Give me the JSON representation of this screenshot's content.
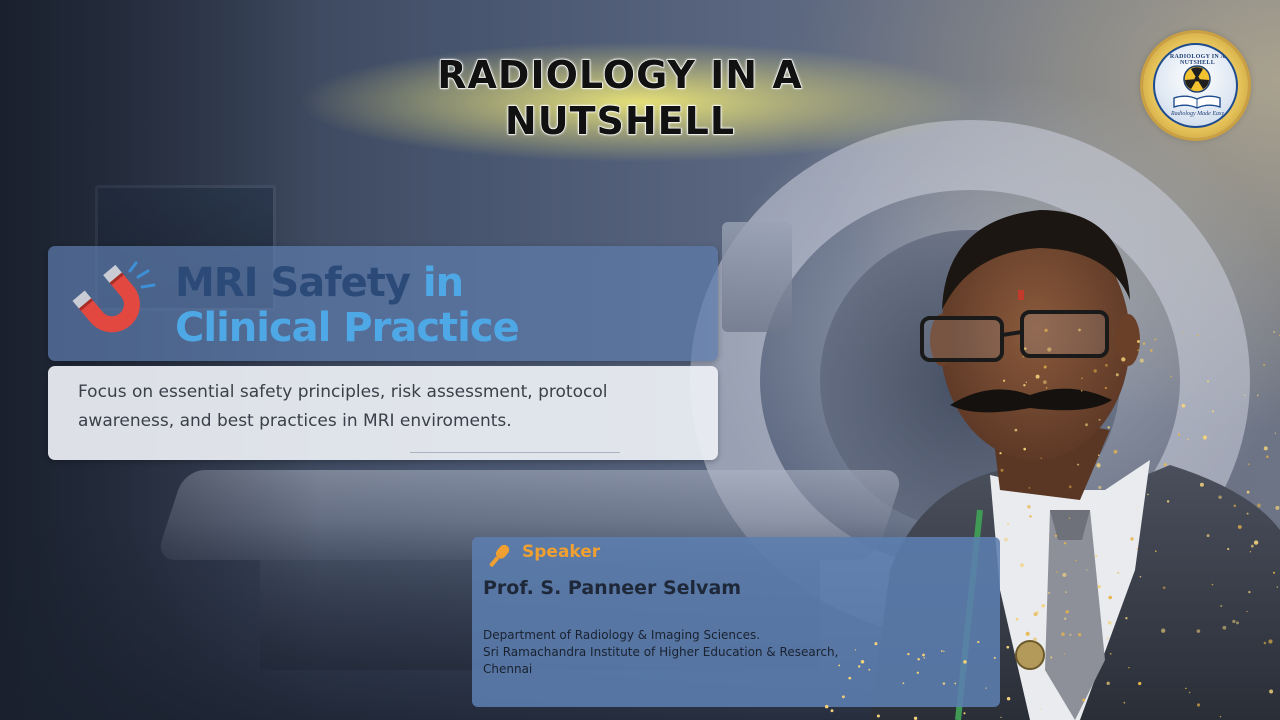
{
  "banner": {
    "title": "RADIOLOGY IN A NUTSHELL"
  },
  "logo": {
    "top_text": "RADIOLOGY IN A NUTSHELL",
    "bottom_text": "Radiology Made Easy"
  },
  "topic": {
    "heading_part1": "MRI Safety",
    "heading_part2": " in",
    "heading_line2": "Clinical Practice",
    "description": "Focus on essential safety principles, risk assessment, protocol awareness, and best practices in MRI enviroments."
  },
  "speaker": {
    "label": "Speaker",
    "name": "Prof. S. Panneer Selvam",
    "affiliation_line1": "Department of Radiology & Imaging Sciences.",
    "affiliation_line2": "Sri Ramachandra Institute of Higher Education & Research,",
    "affiliation_line3": "Chennai"
  },
  "colors": {
    "title_band": "#ece678",
    "heading_dark": "#2b4a78",
    "heading_light": "#4fa8e6",
    "speaker_label": "#f0a030",
    "card_blue": "#5c7eaf"
  },
  "icons": {
    "magnet": "magnet-icon",
    "microphone": "microphone-icon",
    "logo_symbol": "radiation-symbol-icon"
  }
}
